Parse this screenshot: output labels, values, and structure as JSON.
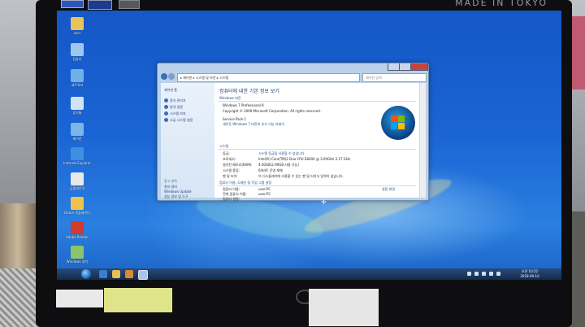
{
  "bezel": {
    "brand_text": "MADE IN TOKYO"
  },
  "window": {
    "address_path": "▸ 제어판 ▸ 시스템 및 보안 ▸ 시스템",
    "search_placeholder": "제어판 검색",
    "pane": {
      "home": "제어판 홈",
      "items": [
        "장치 관리자",
        "원격 설정",
        "시스템 보호",
        "고급 시스템 설정"
      ],
      "see_also_header": "참고 항목",
      "see_also": [
        "관리 센터",
        "Windows Update",
        "성능 정보 및 도구"
      ]
    },
    "content": {
      "title": "컴퓨터에 대한 기본 정보 보기",
      "edition_header": "Windows 버전",
      "edition": "Windows 7 Professional K",
      "copyright": "Copyright © 2009 Microsoft Corporation. All rights reserved.",
      "service_pack": "Service Pack 1",
      "upgrade_link": "새로운 Windows 7 버전의 추가 기능 자세히",
      "system_header": "시스템",
      "rows": [
        {
          "label": "등급:",
          "value": "시스템 등급을 사용할 수 없습니다."
        },
        {
          "label": "프로세서:",
          "value": "Intel(R) Core(TM)2 Duo CPU   E8400 @ 3.00GHz   3.17 GHz"
        },
        {
          "label": "설치된 메모리(RAM):",
          "value": "4.00GB(2.99GB 사용 가능)"
        },
        {
          "label": "시스템 종류:",
          "value": "64비트 운영 체제"
        },
        {
          "label": "펜 및 터치:",
          "value": "이 디스플레이에 사용할 수 있는 펜 및 터치식 입력이 없습니다."
        }
      ],
      "computer_header": "컴퓨터 이름, 도메인 및 작업 그룹 설정",
      "computer_rows": [
        {
          "label": "컴퓨터 이름:",
          "value": "user-PC"
        },
        {
          "label": "전체 컴퓨터 이름:",
          "value": "user-PC"
        },
        {
          "label": "컴퓨터 설명:",
          "value": ""
        }
      ],
      "change_settings": "설정 변경"
    }
  },
  "desktop": {
    "icons": [
      {
        "name": "folder-icon",
        "label": "user",
        "color": "#e9c25a"
      },
      {
        "name": "computer-icon",
        "label": "컴퓨터",
        "color": "#9fc7ee"
      },
      {
        "name": "network-icon",
        "label": "네트워크",
        "color": "#6fb1e6"
      },
      {
        "name": "recycle-bin-icon",
        "label": "휴지통",
        "color": "#cfe3f5"
      },
      {
        "name": "control-panel-icon",
        "label": "제어판",
        "color": "#7bb6e8"
      },
      {
        "name": "ie-icon",
        "label": "Internet Explorer",
        "color": "#3f8fe0"
      },
      {
        "name": "gom-icon",
        "label": "곰플레이어",
        "color": "#e8e8e8"
      },
      {
        "name": "player-icon",
        "label": "Daum 팟플레이어",
        "color": "#f0c24a"
      },
      {
        "name": "acrobat-icon",
        "label": "Adobe Reader",
        "color": "#d23a2e"
      },
      {
        "name": "setup-icon",
        "label": "Windows 설치",
        "color": "#8bc46a"
      }
    ]
  },
  "taskbar": {
    "time": "오전 10:22",
    "date": "2018-09-10",
    "accent": "#1a5fb0"
  }
}
